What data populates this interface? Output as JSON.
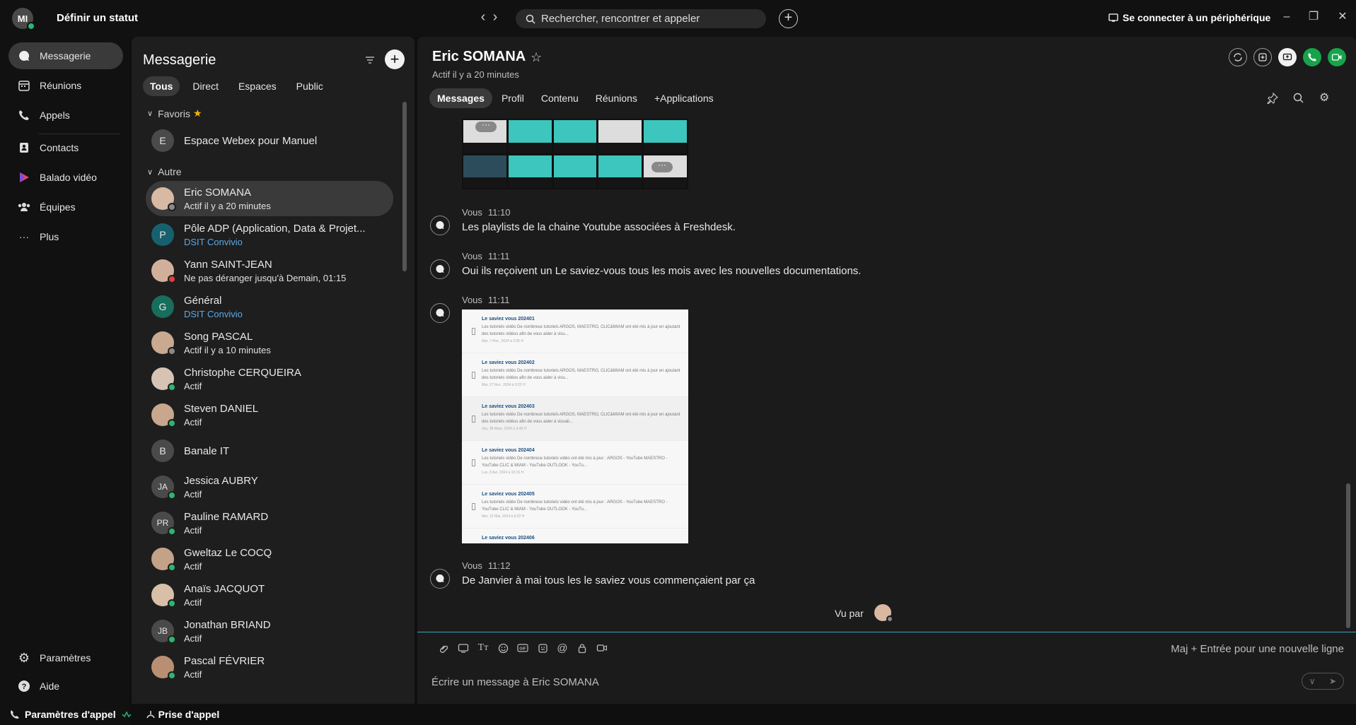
{
  "titlebar": {
    "avatar_initials": "MI",
    "status_label": "Définir un statut",
    "search_placeholder": "Rechercher, rencontrer et appeler",
    "connect_device": "Se connecter à un périphérique"
  },
  "nav": {
    "items": [
      {
        "label": "Messagerie",
        "icon": "message-icon"
      },
      {
        "label": "Réunions",
        "icon": "calendar-icon"
      },
      {
        "label": "Appels",
        "icon": "phone-icon"
      },
      {
        "label": "Contacts",
        "icon": "contacts-icon"
      },
      {
        "label": "Balado vidéo",
        "icon": "vidcast-icon"
      },
      {
        "label": "Équipes",
        "icon": "teams-icon"
      },
      {
        "label": "Plus",
        "icon": "more-icon"
      }
    ],
    "settings": "Paramètres",
    "help": "Aide",
    "call_settings": "Paramètres d'appel",
    "call_pickup": "Prise d'appel"
  },
  "list": {
    "title": "Messagerie",
    "tabs": [
      "Tous",
      "Direct",
      "Espaces",
      "Public"
    ],
    "favorites_label": "Favoris",
    "other_label": "Autre",
    "favorites": [
      {
        "initials": "E",
        "name": "Espace Webex pour Manuel",
        "sub": ""
      }
    ],
    "conversations": [
      {
        "initials": "",
        "name": "Eric SOMANA",
        "sub": "Actif il y a 20 minutes"
      },
      {
        "initials": "P",
        "name": "Pôle ADP (Application, Data & Projet...",
        "sub": "DSIT Convivio"
      },
      {
        "initials": "",
        "name": "Yann SAINT-JEAN",
        "sub": "Ne pas déranger jusqu'à Demain, 01:15"
      },
      {
        "initials": "G",
        "name": "Général",
        "sub": "DSIT Convivio"
      },
      {
        "initials": "",
        "name": "Song PASCAL",
        "sub": "Actif il y a 10 minutes"
      },
      {
        "initials": "",
        "name": "Christophe CERQUEIRA",
        "sub": "Actif"
      },
      {
        "initials": "",
        "name": "Steven DANIEL",
        "sub": "Actif"
      },
      {
        "initials": "B",
        "name": "Banale IT",
        "sub": ""
      },
      {
        "initials": "JA",
        "name": "Jessica AUBRY",
        "sub": "Actif"
      },
      {
        "initials": "PR",
        "name": "Pauline RAMARD",
        "sub": "Actif"
      },
      {
        "initials": "",
        "name": "Gweltaz Le COCQ",
        "sub": "Actif"
      },
      {
        "initials": "",
        "name": "Anaïs JACQUOT",
        "sub": "Actif"
      },
      {
        "initials": "JB",
        "name": "Jonathan BRIAND",
        "sub": "Actif"
      },
      {
        "initials": "",
        "name": "Pascal FÉVRIER",
        "sub": "Actif"
      }
    ]
  },
  "chat": {
    "name": "Eric SOMANA",
    "status": "Actif il y a 20 minutes",
    "tabs": [
      "Messages",
      "Profil",
      "Contenu",
      "Réunions",
      "+Applications"
    ],
    "messages": [
      {
        "author": "Vous",
        "time": "11:10",
        "text": "Les playlists de la chaine Youtube associées à Freshdesk."
      },
      {
        "author": "Vous",
        "time": "11:11",
        "text": "Oui ils reçoivent un Le saviez-vous tous les mois avec les nouvelles documentations."
      },
      {
        "author": "Vous",
        "time": "11:11",
        "text": ""
      },
      {
        "author": "Vous",
        "time": "11:12",
        "text": "De Janvier à mai tous les le saviez vous commençaient par ça"
      }
    ],
    "doc_entries": [
      {
        "title": "Le saviez vous 202401",
        "desc": "Les tutoriels vidéo De nombreux tutoriels ARGOS, MAESTRO, CLIC&MIAM ont été mis à jour en ajoutant",
        "desc2": "des tutoriels vidéos afin de vous aider à visu...",
        "date": "Mar, 7 févr., 2024 à 3:36 H"
      },
      {
        "title": "Le saviez vous 202402",
        "desc": "Les tutoriels vidéo De nombreux tutoriels ARGOS, MAESTRO, CLIC&MIAM ont été mis à jour en ajoutant",
        "desc2": "des tutoriels vidéos afin de vous aider à visu...",
        "date": "Mar, 27 févr., 2024 à 9:22 H"
      },
      {
        "title": "Le saviez vous 202403",
        "desc": "Les tutoriels vidéo De nombreux tutoriels ARGOS, MAESTRO, CLIC&MIAM ont été mis à jour en ajoutant",
        "desc2": "des tutoriels vidéos afin de vous aider à visuali...",
        "date": "Jeu, 28 Mars, 2024 à 3:49 H"
      },
      {
        "title": "Le saviez vous 202404",
        "desc": "Les tutoriels vidéo De nombreux tutoriels vidéo ont été mis à jour : ARGOS - YouTube MAESTRO -",
        "desc2": "YouTube CLIC & MIAM - YouTube OUTLOOK - YouTu...",
        "date": "Lun, 8 Avr, 2024 à 10:15 H"
      },
      {
        "title": "Le saviez vous 202405",
        "desc": "Les tutoriels vidéo De nombreux tutoriels vidéo ont été mis à jour : ARGOS - YouTube MAESTRO -",
        "desc2": "YouTube CLIC & MIAM - YouTube OUTLOOK - YouTu...",
        "date": "Mer, 15 Mai, 2024 à 9:22 H"
      },
      {
        "title": "Le saviez vous 202406",
        "desc": "",
        "desc2": "",
        "date": ""
      }
    ],
    "seen_by": "Vu par",
    "hint": "Maj + Entrée pour une nouvelle ligne",
    "composer_placeholder": "Écrire un message à Eric SOMANA"
  },
  "colors": {
    "accent_green": "#17a34a",
    "presence_green": "#2bb673",
    "dnd_red": "#e23d3d",
    "link_blue": "#5aa9e6",
    "compose_line": "#3aa6c2"
  }
}
